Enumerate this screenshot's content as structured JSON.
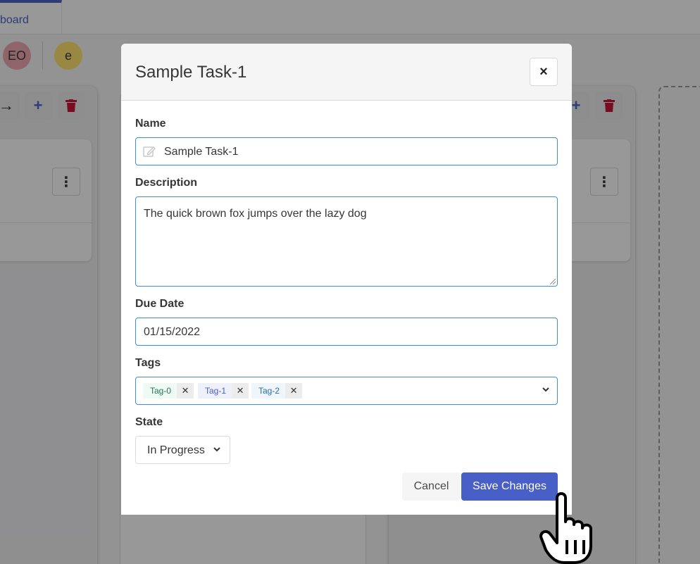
{
  "board": {
    "tab_label": "board",
    "avatars": [
      "EO",
      "e"
    ],
    "column_icons": [
      "arrow-right-icon",
      "plus-icon",
      "trash-icon",
      "kebab-icon"
    ]
  },
  "modal": {
    "title": "Sample Task-1",
    "close_icon": "×",
    "name_label": "Name",
    "name_value": "Sample Task-1",
    "description_label": "Description",
    "description_value": "The quick brown fox jumps over the lazy dog",
    "due_date_label": "Due Date",
    "due_date_value": "01/15/2022",
    "tags_label": "Tags",
    "tags": [
      "Tag-0",
      "Tag-1",
      "Tag-2"
    ],
    "tag_remove": "✕",
    "state_label": "State",
    "state_value": "In Progress",
    "cancel_label": "Cancel",
    "save_label": "Save Changes"
  },
  "colors": {
    "primary": "#485fc7",
    "input_border": "#3e8ed0",
    "overlay": "rgba(10,10,10,0.42)",
    "tag0": "#257953",
    "tag1": "#485fc7",
    "tag2": "#296fa8"
  }
}
